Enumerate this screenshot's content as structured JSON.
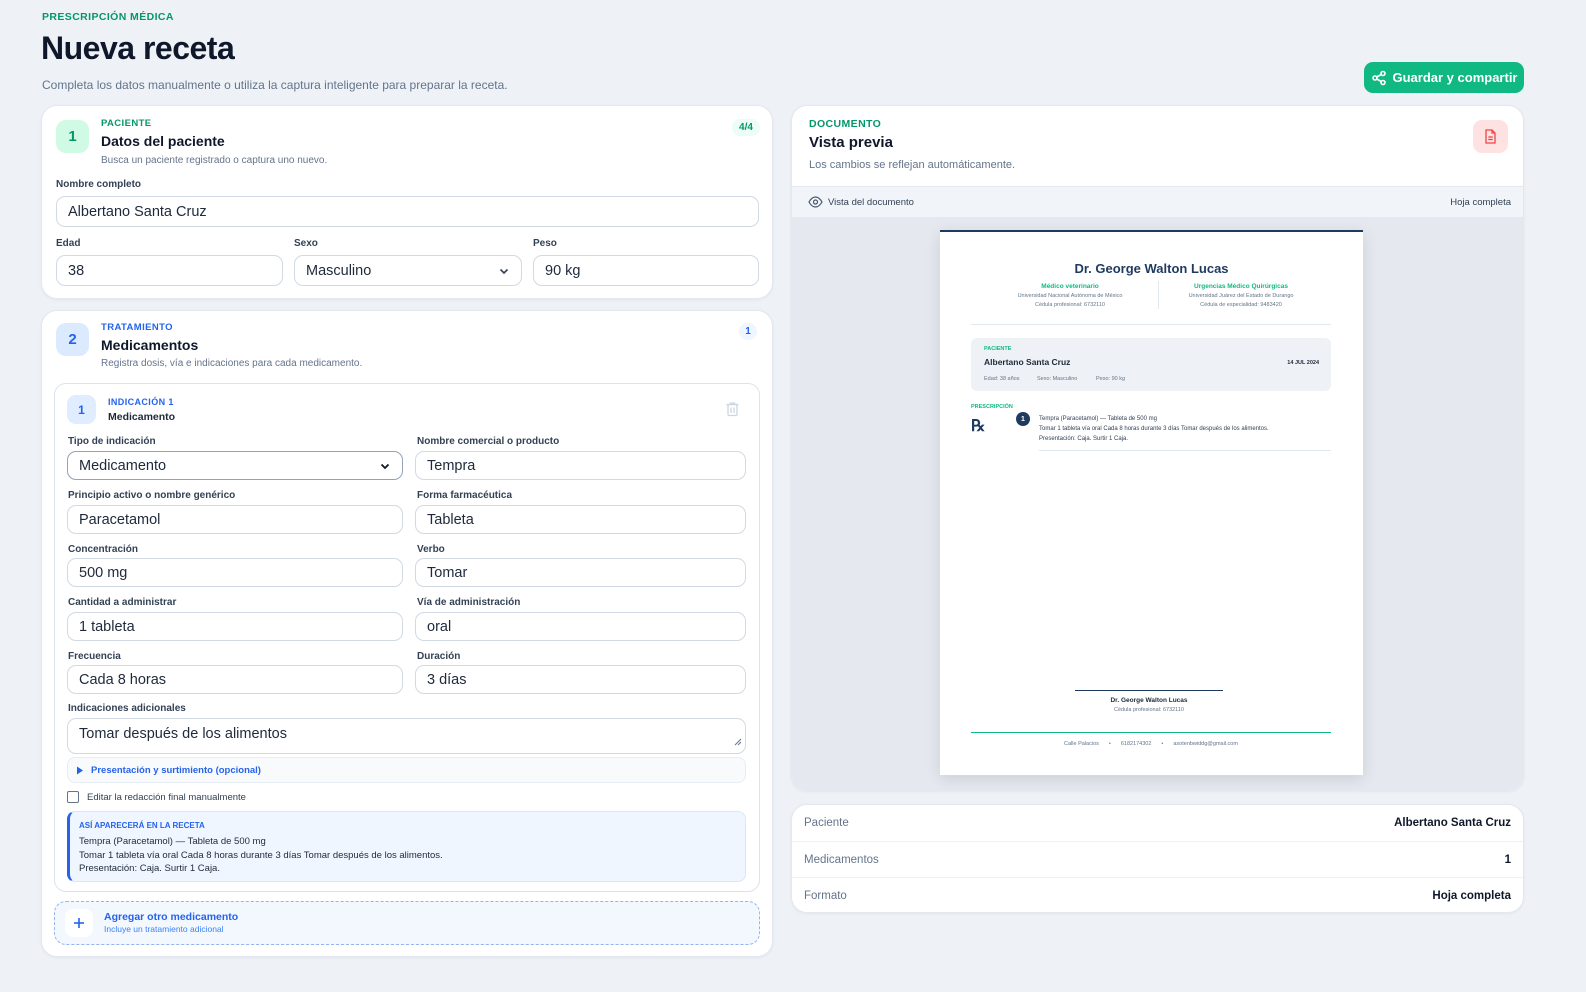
{
  "header": {
    "eyebrow": "PRESCRIPCIÓN MÉDICA",
    "title": "Nueva receta",
    "subtitle": "Completa los datos manualmente o utiliza la captura inteligente para preparar la receta.",
    "save_share_label": "Guardar y compartir"
  },
  "patient_card": {
    "step": "1",
    "eyebrow": "PACIENTE",
    "title": "Datos del paciente",
    "subtitle": "Busca un paciente registrado o captura uno nuevo.",
    "progress": "4/4",
    "full_name_label": "Nombre completo",
    "full_name": "Albertano Santa Cruz",
    "age_label": "Edad",
    "age": "38",
    "sex_label": "Sexo",
    "sex": "Masculino",
    "weight_label": "Peso",
    "weight": "90 kg"
  },
  "treatment_card": {
    "step": "2",
    "eyebrow": "TRATAMIENTO",
    "title": "Medicamentos",
    "subtitle": "Registra dosis, vía e indicaciones para cada medicamento.",
    "count": "1",
    "indication": {
      "number": "1",
      "eyebrow": "INDICACIÓN 1",
      "type_title": "Medicamento",
      "type_label": "Tipo de indicación",
      "type_value": "Medicamento",
      "product_label": "Nombre comercial o producto",
      "product_value": "Tempra",
      "generic_label": "Principio activo o nombre genérico",
      "generic_value": "Paracetamol",
      "form_label": "Forma farmacéutica",
      "form_value": "Tableta",
      "concentration_label": "Concentración",
      "concentration_value": "500 mg",
      "verb_label": "Verbo",
      "verb_value": "Tomar",
      "quantity_label": "Cantidad a administrar",
      "quantity_value": "1 tableta",
      "route_label": "Vía de administración",
      "route_value": "oral",
      "frequency_label": "Frecuencia",
      "frequency_value": "Cada 8 horas",
      "duration_label": "Duración",
      "duration_value": "3 días",
      "extra_label": "Indicaciones adicionales",
      "extra_value": "Tomar después de los alimentos",
      "presentation_toggle": "Presentación y surtimiento (opcional)",
      "manual_edit_label": "Editar la redacción final manualmente",
      "preview_eyebrow": "ASÍ APARECERÁ EN LA RECETA",
      "preview_line1": "Tempra (Paracetamol) — Tableta de 500 mg",
      "preview_line2": "Tomar 1 tableta vía oral Cada 8 horas durante 3 días Tomar después de los alimentos.",
      "preview_line3": "Presentación: Caja. Surtir 1 Caja."
    },
    "add_title": "Agregar otro medicamento",
    "add_subtitle": "Incluye un tratamiento adicional"
  },
  "preview_card": {
    "eyebrow": "DOCUMENTO",
    "title": "Vista previa",
    "subtitle": "Los cambios se reflejan automáticamente.",
    "toolbar_label": "Vista del documento",
    "format_label": "Hoja completa"
  },
  "document": {
    "doctor_name": "Dr. George Walton Lucas",
    "spec1_title": "Médico veterinario",
    "spec1_line1": "Universidad Nacional Autónoma de México",
    "spec1_line2": "Cédula profesional: 6732110",
    "spec2_title": "Urgencias Médico Quirúrgicas",
    "spec2_line1": "Universidad Juárez del Estado de Durango",
    "spec2_line2": "Cédula de especialidad: 9483420",
    "patient_eyebrow": "PACIENTE",
    "patient_name": "Albertano Santa Cruz",
    "date": "14 JUL 2024",
    "age": "Edad: 38 años",
    "sex": "Sexo: Masculino",
    "weight": "Peso: 90 kg",
    "rx_eyebrow": "PRESCRIPCIÓN",
    "rx_symbol": "℞",
    "item_number": "1",
    "item_line1": "Tempra (Paracetamol) — Tableta de 500 mg",
    "item_line2": "Tomar 1 tableta vía oral Cada 8 horas durante 3 días Tomar después de los alimentos.",
    "item_line3": "Presentación: Caja. Surtir 1 Caja.",
    "signature_name": "Dr. George Walton Lucas",
    "signature_license": "Cédula profesional: 6732110",
    "footer_address": "Calle Palacios",
    "footer_phone": "6182174302",
    "footer_email": "asotenbwiddg@gmail.com"
  },
  "summary": {
    "rows": [
      {
        "label": "Paciente",
        "value": "Albertano Santa Cruz"
      },
      {
        "label": "Medicamentos",
        "value": "1"
      },
      {
        "label": "Formato",
        "value": "Hoja completa"
      }
    ]
  },
  "colors": {
    "accent_green": "#10b981",
    "accent_blue": "#2563eb",
    "danger": "#ef4444"
  }
}
